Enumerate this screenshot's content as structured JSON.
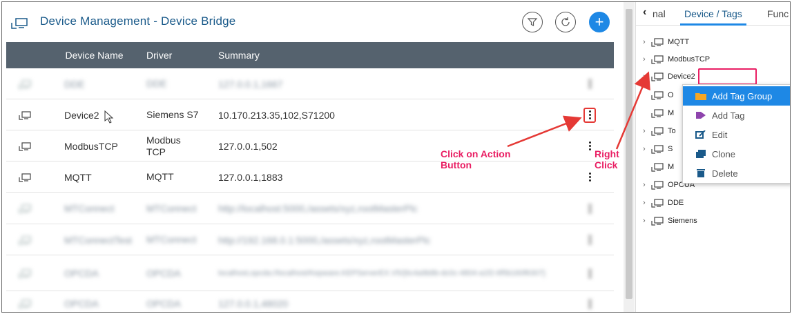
{
  "header": {
    "title": "Device Management - Device Bridge"
  },
  "table": {
    "columns": [
      "Device Name",
      "Driver",
      "Summary"
    ],
    "rows": [
      {
        "name": "DDE",
        "driver": "DDE",
        "summary": "127.0.0.1,1667",
        "blurred": true
      },
      {
        "name": "Device2",
        "driver": "Siemens S7",
        "summary": "10.170.213.35,102,S71200",
        "blurred": false
      },
      {
        "name": "ModbusTCP",
        "driver": "Modbus TCP",
        "summary": "127.0.0.1,502",
        "blurred": false
      },
      {
        "name": "MQTT",
        "driver": "MQTT",
        "summary": "127.0.0.1,1883",
        "blurred": false
      },
      {
        "name": "MTConnect",
        "driver": "MTConnect",
        "summary": "http://localhost:5000,/assets/xyz,rootMasterPlc",
        "blurred": true
      },
      {
        "name": "MTConnectTest",
        "driver": "MTConnect",
        "summary": "http://192.168.0.1:5000,/assets/xyz,rootMasterPlc",
        "blurred": true
      },
      {
        "name": "OPCDA",
        "driver": "OPCDA",
        "summary": "localhost,opcda://localhost/Kepware.KEPServerEX.V5/{6c4a9b8b-dc0c-4804-a1f2-6f5b160f6307}",
        "blurred": true
      },
      {
        "name": "OPCDA",
        "driver": "OPCDA",
        "summary": "127.0.0.1,48020",
        "blurred": true
      }
    ]
  },
  "right_panel": {
    "tabs": [
      "nal",
      "Device / Tags",
      "Func"
    ],
    "active_tab": "Device / Tags",
    "tree": [
      "MQTT",
      "ModbusTCP",
      "Device2",
      "O",
      "M",
      "To",
      "S",
      "M",
      "OPCUA",
      "DDE",
      "Siemens"
    ]
  },
  "context_menu": {
    "items": [
      {
        "label": "Add Tag Group",
        "icon": "folder-icon",
        "color": "#f5a623"
      },
      {
        "label": "Add Tag",
        "icon": "tag-icon",
        "color": "#8e44ad"
      },
      {
        "label": "Edit",
        "icon": "edit-icon",
        "color": "#1a5a8a"
      },
      {
        "label": "Clone",
        "icon": "clone-icon",
        "color": "#1a5a8a"
      },
      {
        "label": "Delete",
        "icon": "trash-icon",
        "color": "#1a5a8a"
      }
    ]
  },
  "annotations": {
    "action": "Click on Action Button",
    "right_click": "Right Click"
  },
  "colors": {
    "accent": "#1e88e5",
    "header_bg": "#55626e",
    "highlight": "#e91e63",
    "title": "#1a5a8a"
  }
}
